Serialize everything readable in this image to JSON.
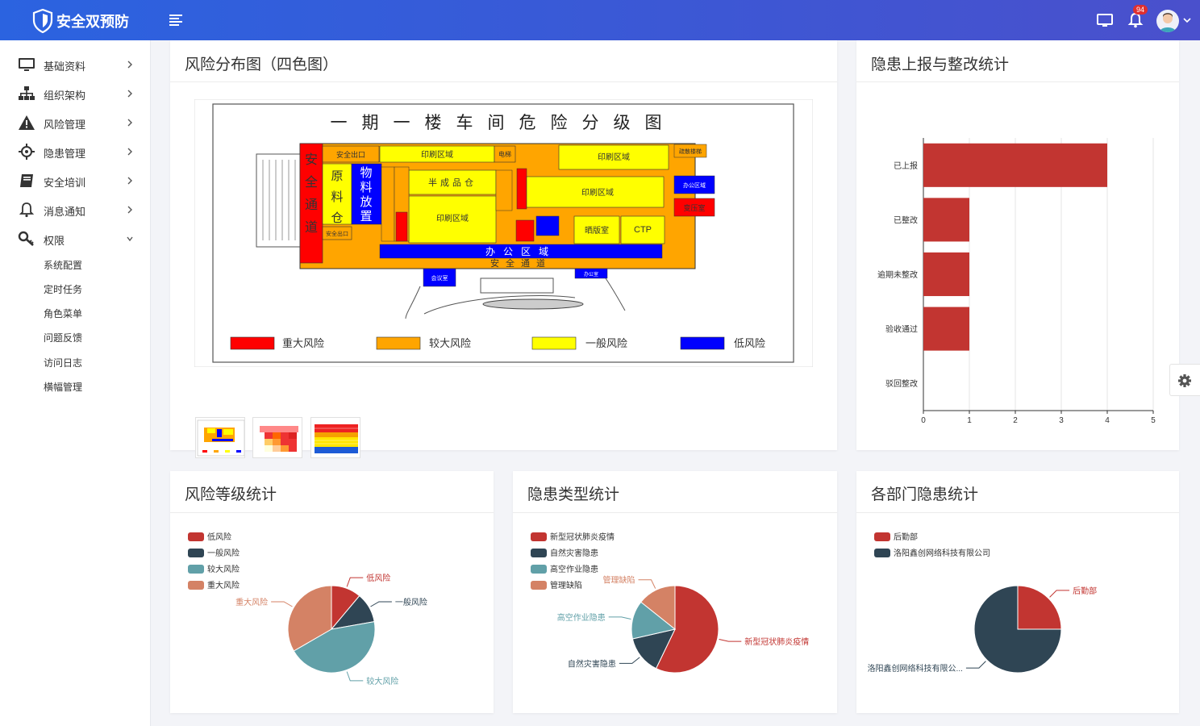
{
  "app": {
    "title": "安全双预防"
  },
  "header": {
    "notification_count": "94"
  },
  "sidebar": {
    "items": [
      {
        "label": "基础资料",
        "icon": "monitor-icon"
      },
      {
        "label": "组织架构",
        "icon": "org-chart-icon"
      },
      {
        "label": "风险管理",
        "icon": "warning-icon"
      },
      {
        "label": "隐患管理",
        "icon": "crosshair-icon"
      },
      {
        "label": "安全培训",
        "icon": "book-icon"
      },
      {
        "label": "消息通知",
        "icon": "bell-icon"
      },
      {
        "label": "权限",
        "icon": "key-icon"
      }
    ],
    "subitems": [
      "系统配置",
      "定时任务",
      "角色菜单",
      "问题反馈",
      "访问日志",
      "横幅管理"
    ]
  },
  "cards": {
    "risk_map": {
      "title": "风险分布图（四色图）",
      "map": {
        "title": "一期一楼车间危险分级图",
        "legend": [
          "重大风险",
          "较大风险",
          "一般风险",
          "低风险"
        ],
        "areas": {
          "safe_exit": "安全出口",
          "print_area": "印刷区域",
          "elevator": "电梯",
          "evac_stair": "疏散楼梯",
          "safe_passage_v": "安全通道",
          "raw_material": "原料仓",
          "material_storage": "物料放置",
          "semi_finished": "半成品仓",
          "material_small": "物料放置",
          "office_area": "办公区域",
          "transformer": "变压室",
          "plate_room": "晒版室",
          "ctp": "CTP",
          "office_zone_main": "办公区域",
          "safe_passage_h": "安全通道",
          "meeting_room": "会议室",
          "office_room": "办公室"
        },
        "colors": {
          "major": "#ff0000",
          "large": "#ffa500",
          "general": "#ffff00",
          "low": "#0000ff"
        }
      }
    },
    "hazard_report": {
      "title": "隐患上报与整改统计",
      "chart_data": {
        "type": "bar",
        "orientation": "horizontal",
        "categories": [
          "已上报",
          "已整改",
          "逾期未整改",
          "验收通过",
          "驳回整改"
        ],
        "values": [
          4,
          1,
          1,
          1,
          0
        ],
        "xlim": [
          0,
          5
        ],
        "xticks": [
          "0",
          "1",
          "2",
          "3",
          "4",
          "5"
        ],
        "color": "#c23531",
        "grid": true
      }
    },
    "risk_level": {
      "title": "风险等级统计",
      "chart_data": {
        "type": "pie",
        "categories": [
          "低风险",
          "一般风险",
          "较大风险",
          "重大风险"
        ],
        "values": [
          1,
          1,
          4,
          3
        ],
        "colors": [
          "#c23531",
          "#2f4554",
          "#61a0a8",
          "#d48265"
        ]
      }
    },
    "hazard_type": {
      "title": "隐患类型统计",
      "chart_data": {
        "type": "pie",
        "categories": [
          "新型冠状肺炎疫情",
          "自然灾害隐患",
          "高空作业隐患",
          "管理缺陷"
        ],
        "values": [
          4,
          1,
          1,
          1
        ],
        "colors": [
          "#c23531",
          "#2f4554",
          "#61a0a8",
          "#d48265"
        ]
      }
    },
    "dept_hazard": {
      "title": "各部门隐患统计",
      "chart_data": {
        "type": "pie",
        "categories": [
          "后勤部",
          "洛阳鑫创网络科技有限公司"
        ],
        "outside_labels": [
          "后勤部",
          "洛阳鑫创网络科技有限公..."
        ],
        "values": [
          1,
          3
        ],
        "colors": [
          "#c23531",
          "#2f4554"
        ]
      }
    }
  }
}
